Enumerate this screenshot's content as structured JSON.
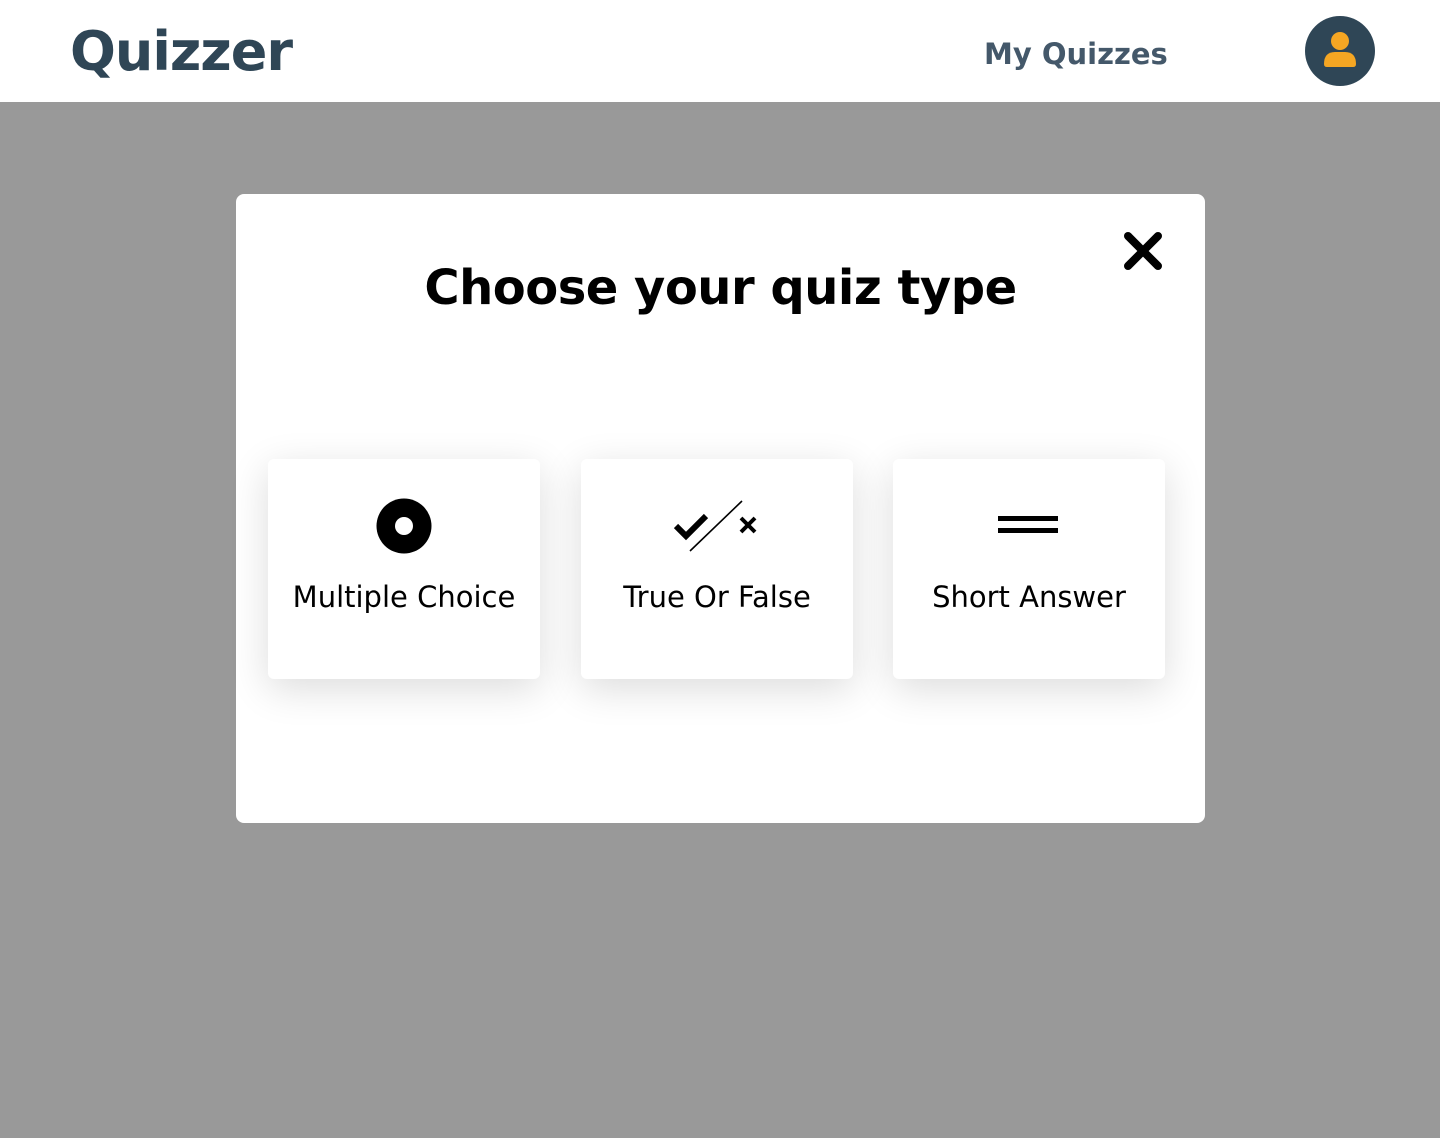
{
  "header": {
    "brand": "Quizzer",
    "nav_link": "My Quizzes",
    "avatar_icon": "user-icon"
  },
  "modal": {
    "title": "Choose your quiz type",
    "close_icon": "close-icon",
    "options": [
      {
        "label": "Multiple Choice",
        "icon": "radio-button-icon"
      },
      {
        "label": "True Or False",
        "icon": "check-slash-x-icon"
      },
      {
        "label": "Short Answer",
        "icon": "equals-lines-icon"
      }
    ]
  },
  "colors": {
    "brand": "#2f4656",
    "nav_link": "#44586a",
    "avatar_bg": "#2f4656",
    "avatar_icon": "#f5a623",
    "overlay": "#999999"
  }
}
